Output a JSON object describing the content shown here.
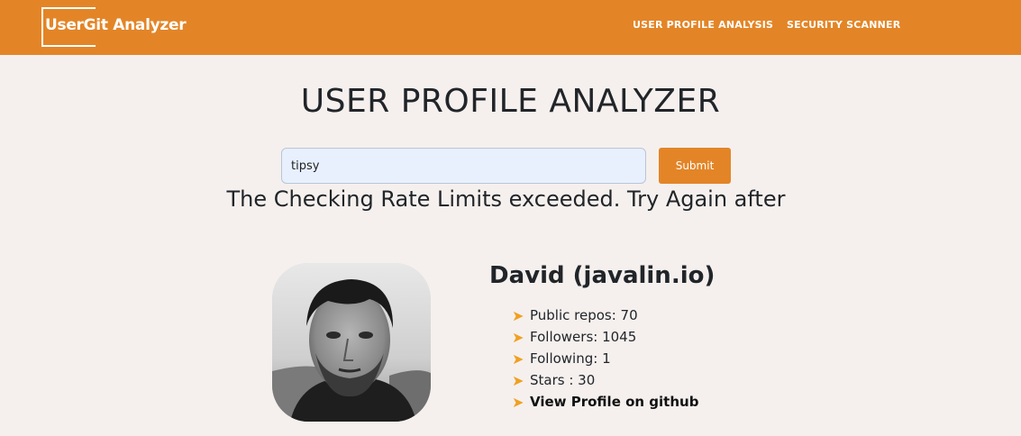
{
  "brand": {
    "logo_text": "UserGit Analyzer"
  },
  "nav": {
    "items": [
      {
        "label": "USER PROFILE ANALYSIS"
      },
      {
        "label": "SECURITY SCANNER"
      }
    ]
  },
  "main": {
    "title": "USER PROFILE ANALYZER",
    "search": {
      "value": "tipsy",
      "placeholder": ""
    },
    "submit_label": "Submit",
    "rate_message": "The Checking Rate Limits exceeded. Try Again after"
  },
  "profile": {
    "name": "David (javalin.io)",
    "stats": [
      {
        "text": "Public repos: 70"
      },
      {
        "text": "Followers: 1045"
      },
      {
        "text": "Following: 1"
      },
      {
        "text": "Stars : 30"
      }
    ],
    "profile_link": "View Profile on github",
    "bullet_icon": "arrow-right-icon",
    "bullet_color": "#f0a020"
  },
  "colors": {
    "accent": "#e38527",
    "background": "#f5f0ee",
    "input_bg": "#e8f0fe"
  }
}
